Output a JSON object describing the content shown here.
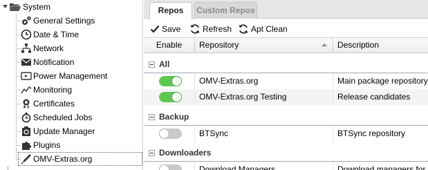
{
  "tree": {
    "root": {
      "label": "System",
      "icon": "folder-open-icon"
    },
    "items": [
      {
        "name": "general-settings",
        "label": "General Settings",
        "icon": "gears-icon"
      },
      {
        "name": "date-time",
        "label": "Date & Time",
        "icon": "clock-icon"
      },
      {
        "name": "network",
        "label": "Network",
        "icon": "network-icon"
      },
      {
        "name": "notification",
        "label": "Notification",
        "icon": "envelope-icon"
      },
      {
        "name": "power-management",
        "label": "Power Management",
        "icon": "power-icon"
      },
      {
        "name": "monitoring",
        "label": "Monitoring",
        "icon": "line-chart-icon"
      },
      {
        "name": "certificates",
        "label": "Certificates",
        "icon": "certificate-icon"
      },
      {
        "name": "scheduled-jobs",
        "label": "Scheduled Jobs",
        "icon": "stopwatch-icon"
      },
      {
        "name": "update-manager",
        "label": "Update Manager",
        "icon": "update-icon"
      },
      {
        "name": "plugins",
        "label": "Plugins",
        "icon": "puzzle-icon"
      },
      {
        "name": "omv-extras",
        "label": "OMV-Extras.org",
        "icon": "pen-icon",
        "selected": true
      }
    ]
  },
  "tabs": [
    {
      "label": "Repos",
      "active": true
    },
    {
      "label": "Custom Repos",
      "active": false
    }
  ],
  "toolbar": {
    "save_label": "Save",
    "refresh_label": "Refresh",
    "apt_clean_label": "Apt Clean"
  },
  "grid": {
    "columns": {
      "enable": "Enable",
      "repository": "Repository",
      "description": "Description"
    },
    "groups": [
      {
        "label": "All",
        "rows": [
          {
            "enabled": true,
            "repository": "OMV-Extras.org",
            "description": "Main package repository"
          },
          {
            "enabled": true,
            "repository": "OMV-Extras.org Testing",
            "description": "Release candidates"
          }
        ]
      },
      {
        "label": "Backup",
        "rows": [
          {
            "enabled": false,
            "repository": "BTSync",
            "description": "BTSync repository"
          }
        ]
      },
      {
        "label": "Downloaders",
        "rows": [
          {
            "enabled": false,
            "repository": "Download Managers",
            "description": "Download managers for ne"
          }
        ]
      }
    ]
  },
  "colors": {
    "switch_on": "#5fc655",
    "switch_off": "#c9c9c9",
    "tab_bar": "#e6e6e6"
  }
}
